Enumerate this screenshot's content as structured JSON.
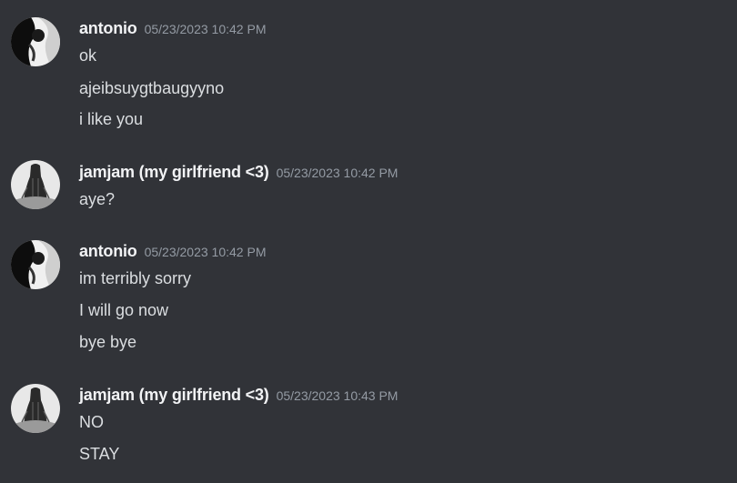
{
  "messages": [
    {
      "author": "antonio",
      "timestamp": "05/23/2023 10:42 PM",
      "avatar_icon": "abstract-black-white-avatar",
      "lines": [
        "ok",
        "ajeibsuygtbaugyyno",
        "i like you"
      ]
    },
    {
      "author": "jamjam (my girlfriend <3)",
      "timestamp": "05/23/2023 10:42 PM",
      "avatar_icon": "sketch-figure-avatar",
      "lines": [
        "aye?"
      ]
    },
    {
      "author": "antonio",
      "timestamp": "05/23/2023 10:42 PM",
      "avatar_icon": "abstract-black-white-avatar",
      "lines": [
        "im terribly sorry",
        "I will go now",
        "bye bye"
      ]
    },
    {
      "author": "jamjam (my girlfriend <3)",
      "timestamp": "05/23/2023 10:43 PM",
      "avatar_icon": "sketch-figure-avatar",
      "lines": [
        "NO",
        "STAY"
      ]
    }
  ],
  "colors": {
    "background": "#313338",
    "username": "#f2f3f5",
    "timestamp": "#949ba4",
    "message_text": "#dbdee1"
  }
}
